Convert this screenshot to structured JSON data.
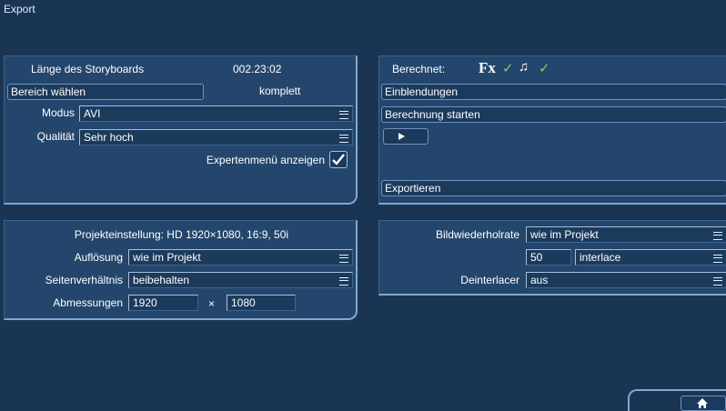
{
  "window": {
    "title": "Export"
  },
  "left_top": {
    "storyboard_length_label": "Länge des Storyboards",
    "storyboard_length_value": "002.23:02",
    "select_range_button": "Bereich wählen",
    "range_value": "komplett",
    "mode_label": "Modus",
    "mode_value": "AVI",
    "quality_label": "Qualität",
    "quality_value": "Sehr hoch",
    "expert_menu_label": "Expertenmenü anzeigen",
    "expert_menu_checked": true
  },
  "right_top": {
    "calculated_label": "Berechnet:",
    "fx_text": "Fx",
    "fx_check": "✓",
    "music_note": "♫",
    "music_check": "✓",
    "fade_ins_button": "Einblendungen",
    "start_calc_button": "Berechnung starten",
    "export_button": "Exportieren"
  },
  "left_bottom": {
    "project_setting": "Projekteinstellung: HD 1920×1080, 16:9, 50i",
    "resolution_label": "Auflösung",
    "resolution_value": "wie im Projekt",
    "aspect_label": "Seitenverhältnis",
    "aspect_value": "beibehalten",
    "dimensions_label": "Abmessungen",
    "width_value": "1920",
    "times_sign": "×",
    "height_value": "1080"
  },
  "right_bottom": {
    "framerate_label": "Bildwiederholrate",
    "framerate_value": "wie im Projekt",
    "fps_value": "50",
    "scan_value": "interlace",
    "deinterlacer_label": "Deinterlacer",
    "deinterlacer_value": "aus"
  },
  "colors": {
    "background": "#1a3553",
    "panel": "#24466c",
    "border_light": "#86a7cd",
    "check_green": "#7fd35a"
  },
  "icons": [
    "menu-icon",
    "play-icon",
    "home-icon",
    "check-icon",
    "music-note-icon"
  ]
}
